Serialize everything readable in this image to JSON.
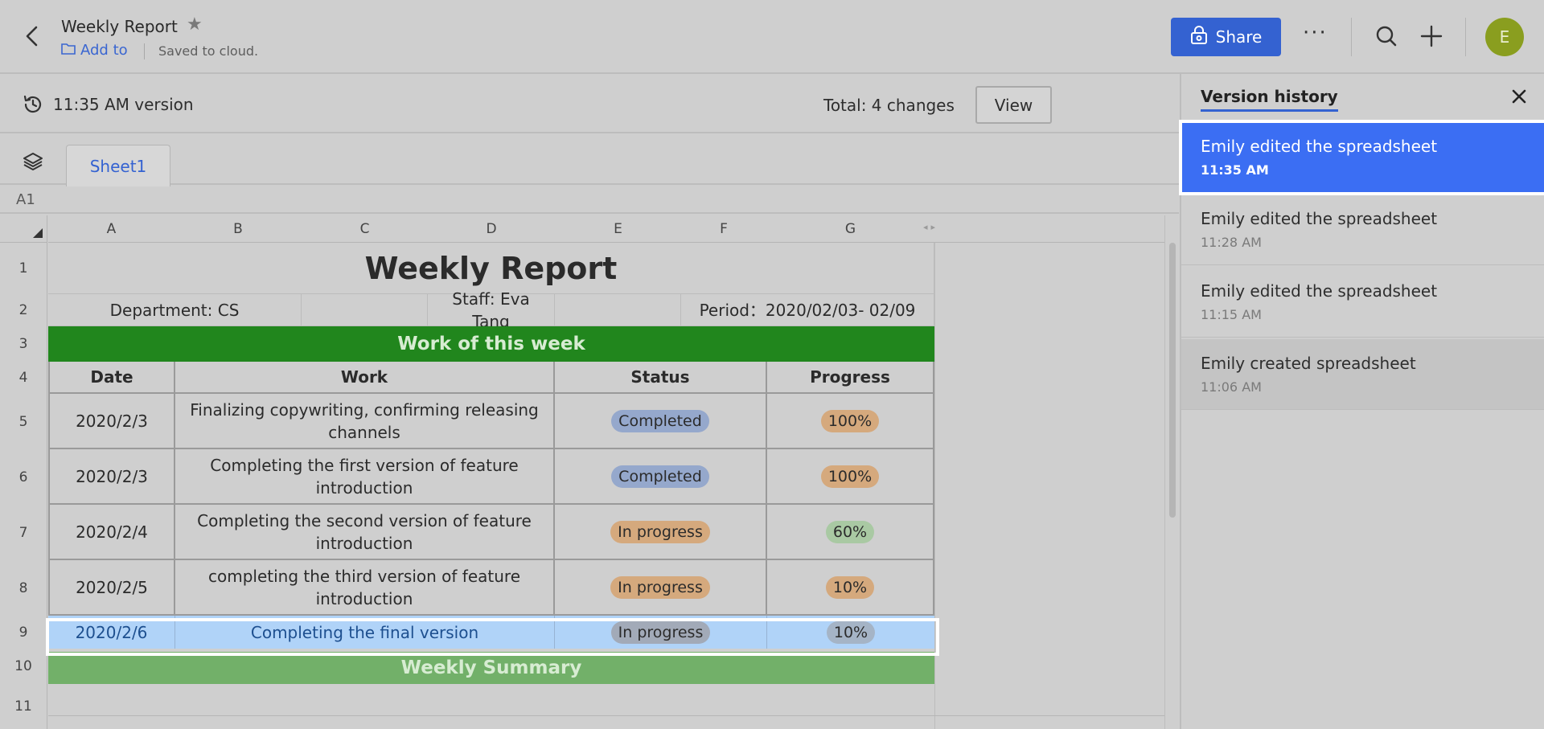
{
  "header": {
    "doc_title": "Weekly Report",
    "add_to_label": "Add to",
    "save_status": "Saved to cloud.",
    "share_label": "Share",
    "more_label": "···",
    "avatar_initial": "E"
  },
  "version_bar": {
    "version_label": "11:35 AM version",
    "total_changes": "Total: 4 changes",
    "view_label": "View"
  },
  "sheet": {
    "tab_name": "Sheet1",
    "name_box": "A1",
    "columns": [
      "A",
      "B",
      "C",
      "D",
      "E",
      "F",
      "G"
    ],
    "rows": [
      "1",
      "2",
      "3",
      "4",
      "5",
      "6",
      "7",
      "8",
      "9",
      "10",
      "11"
    ],
    "title": "Weekly Report",
    "department": "Department: CS",
    "staff": "Staff: Eva Tang",
    "period": "Period：2020/02/03- 02/09",
    "section_header": "Work of this week",
    "headers": [
      "Date",
      "Work",
      "Status",
      "Progress"
    ],
    "data_rows": [
      {
        "date": "2020/2/3",
        "work": "Finalizing copywriting, confirming releasing channels",
        "status": "Completed",
        "progress": "100%"
      },
      {
        "date": "2020/2/3",
        "work": "Completing the first version of feature introduction",
        "status": "Completed",
        "progress": "100%"
      },
      {
        "date": "2020/2/4",
        "work": "Completing the second version of feature introduction",
        "status": "In progress",
        "progress": "60%"
      },
      {
        "date": "2020/2/5",
        "work": "completing the third version of feature introduction",
        "status": "In progress",
        "progress": "10%"
      },
      {
        "date": "2020/2/6",
        "work": "Completing the final version",
        "status": "In progress",
        "progress": "10%"
      }
    ],
    "summary_header": "Weekly Summary"
  },
  "version_history": {
    "title": "Version history",
    "items": [
      {
        "who": "Emily edited the spreadsheet",
        "when": "11:35 AM",
        "active": true
      },
      {
        "who": "Emily edited the spreadsheet",
        "when": "11:28 AM"
      },
      {
        "who": "Emily edited the spreadsheet",
        "when": "11:15 AM"
      },
      {
        "who": "Emily created spreadsheet",
        "when": "11:06 AM"
      }
    ]
  },
  "colors": {
    "accent": "#3462d1",
    "active_version": "#3b6ef3",
    "section_green": "#21861d",
    "summary_green": "#72b069",
    "selected_row": "#b0d3f8"
  }
}
